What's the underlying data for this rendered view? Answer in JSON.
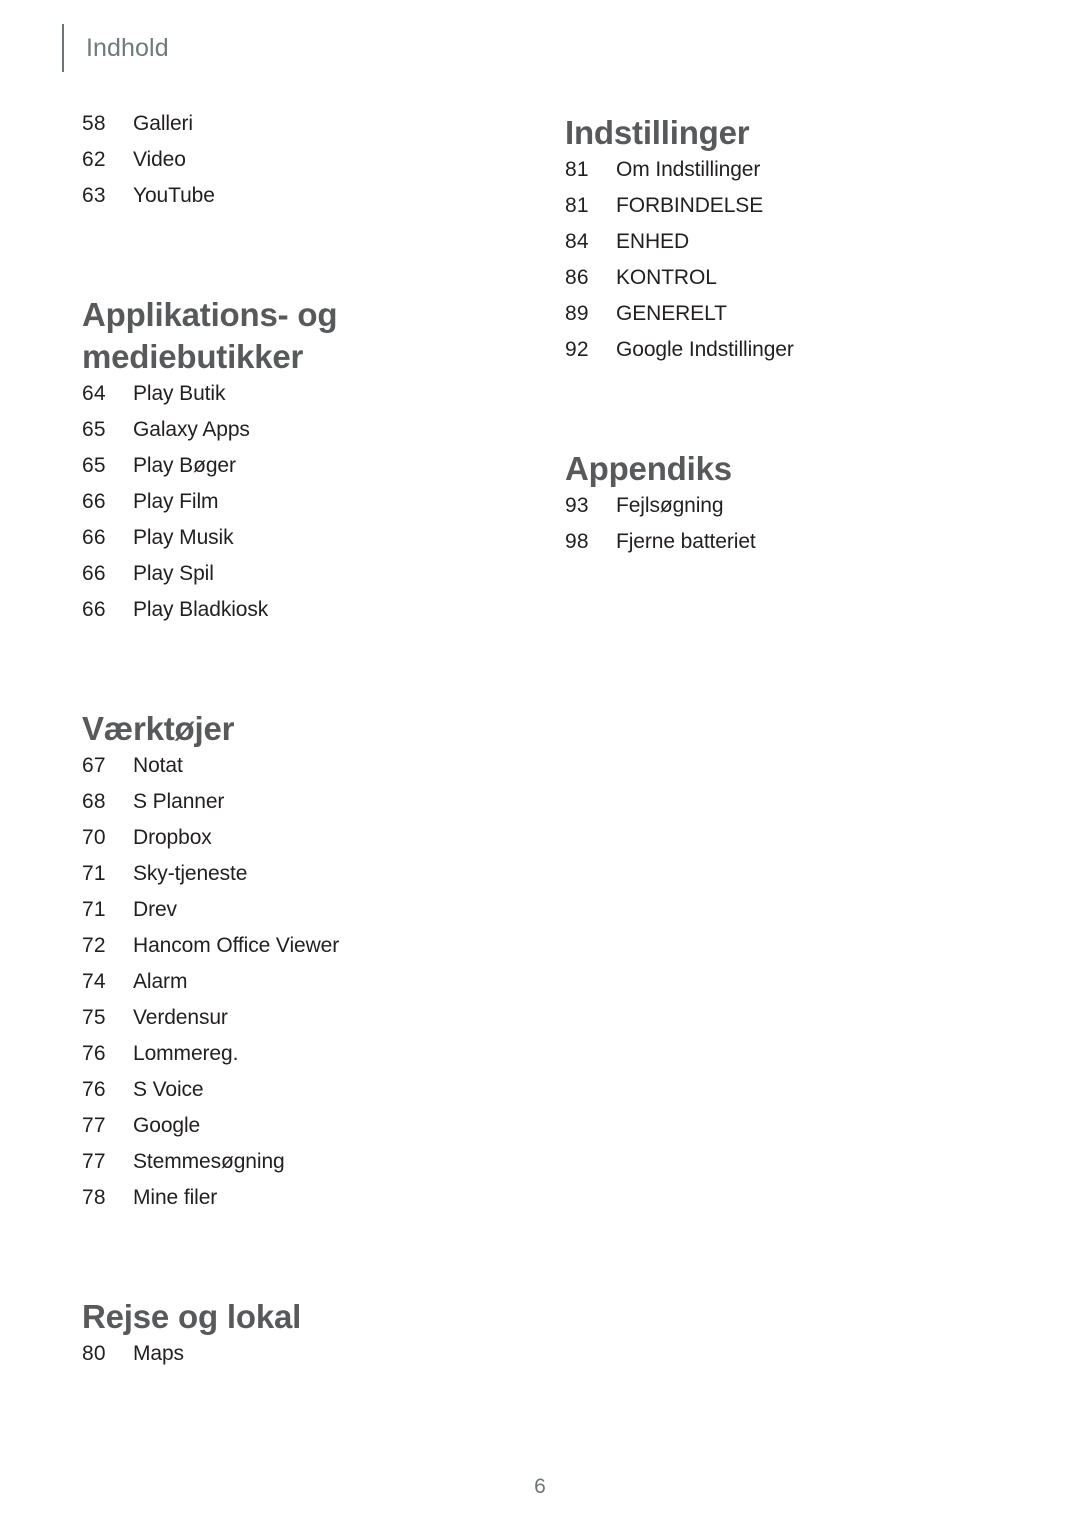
{
  "header": {
    "title": "Indhold"
  },
  "footer": {
    "page_number": "6"
  },
  "colors": {
    "heading": "#58595b",
    "entry_text": "#231f20",
    "header_text": "#70797d",
    "rule": "#6d7579",
    "background": "#ffffff"
  },
  "left_column": {
    "blocks": [
      {
        "type": "entries",
        "entries": [
          {
            "page": "58",
            "label": "Galleri"
          },
          {
            "page": "62",
            "label": "Video"
          },
          {
            "page": "63",
            "label": "YouTube"
          }
        ]
      },
      {
        "type": "section",
        "heading": "Applikations- og\nmediebutikker",
        "entries": [
          {
            "page": "64",
            "label": "Play Butik"
          },
          {
            "page": "65",
            "label": "Galaxy Apps"
          },
          {
            "page": "65",
            "label": "Play Bøger"
          },
          {
            "page": "66",
            "label": "Play Film"
          },
          {
            "page": "66",
            "label": "Play Musik"
          },
          {
            "page": "66",
            "label": "Play Spil"
          },
          {
            "page": "66",
            "label": "Play Bladkiosk"
          }
        ]
      },
      {
        "type": "section",
        "heading": "Værktøjer",
        "entries": [
          {
            "page": "67",
            "label": "Notat"
          },
          {
            "page": "68",
            "label": "S Planner"
          },
          {
            "page": "70",
            "label": "Dropbox"
          },
          {
            "page": "71",
            "label": "Sky-tjeneste"
          },
          {
            "page": "71",
            "label": "Drev"
          },
          {
            "page": "72",
            "label": "Hancom Office Viewer"
          },
          {
            "page": "74",
            "label": "Alarm"
          },
          {
            "page": "75",
            "label": "Verdensur"
          },
          {
            "page": "76",
            "label": "Lommereg."
          },
          {
            "page": "76",
            "label": "S Voice"
          },
          {
            "page": "77",
            "label": "Google"
          },
          {
            "page": "77",
            "label": "Stemmesøgning"
          },
          {
            "page": "78",
            "label": "Mine filer"
          }
        ]
      },
      {
        "type": "section",
        "heading": "Rejse og lokal",
        "entries": [
          {
            "page": "80",
            "label": "Maps"
          }
        ]
      }
    ]
  },
  "right_column": {
    "blocks": [
      {
        "type": "section",
        "heading": "Indstillinger",
        "entries": [
          {
            "page": "81",
            "label": "Om Indstillinger"
          },
          {
            "page": "81",
            "label": "FORBINDELSE"
          },
          {
            "page": "84",
            "label": "ENHED"
          },
          {
            "page": "86",
            "label": "KONTROL"
          },
          {
            "page": "89",
            "label": "GENERELT"
          },
          {
            "page": "92",
            "label": "Google Indstillinger"
          }
        ]
      },
      {
        "type": "section",
        "heading": "Appendiks",
        "entries": [
          {
            "page": "93",
            "label": "Fejlsøgning"
          },
          {
            "page": "98",
            "label": "Fjerne batteriet"
          }
        ]
      }
    ]
  }
}
